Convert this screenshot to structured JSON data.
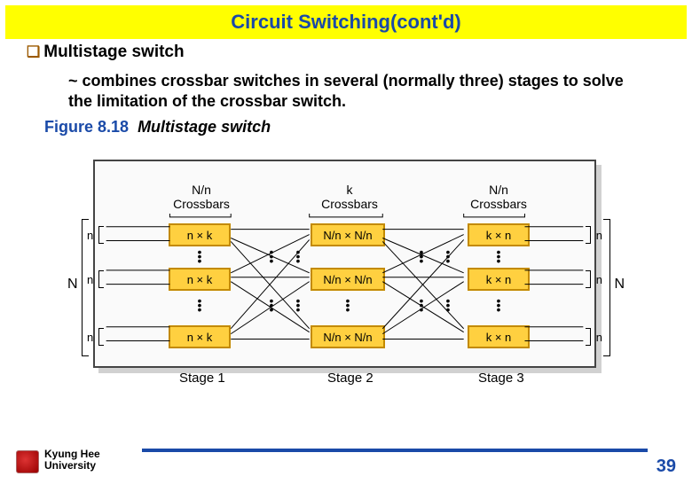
{
  "title": "Circuit Switching(cont'd)",
  "subheading": "Multistage switch",
  "description": "~ combines crossbar switches in several (normally three) stages to solve the limitation of the crossbar switch.",
  "figure": {
    "label": "Figure 8.18",
    "caption": "Multistage switch"
  },
  "diagram": {
    "left_big_label": "N",
    "right_big_label": "N",
    "n_label": "n",
    "columns": [
      {
        "head1": "N/n",
        "head2": "Crossbars",
        "box_label": "n × k",
        "stage": "Stage 1"
      },
      {
        "head1": "k",
        "head2": "Crossbars",
        "box_label": "N/n × N/n",
        "stage": "Stage 2"
      },
      {
        "head1": "N/n",
        "head2": "Crossbars",
        "box_label": "k × n",
        "stage": "Stage 3"
      }
    ]
  },
  "footer": {
    "university1": "Kyung Hee",
    "university2": "University",
    "page": "39"
  }
}
